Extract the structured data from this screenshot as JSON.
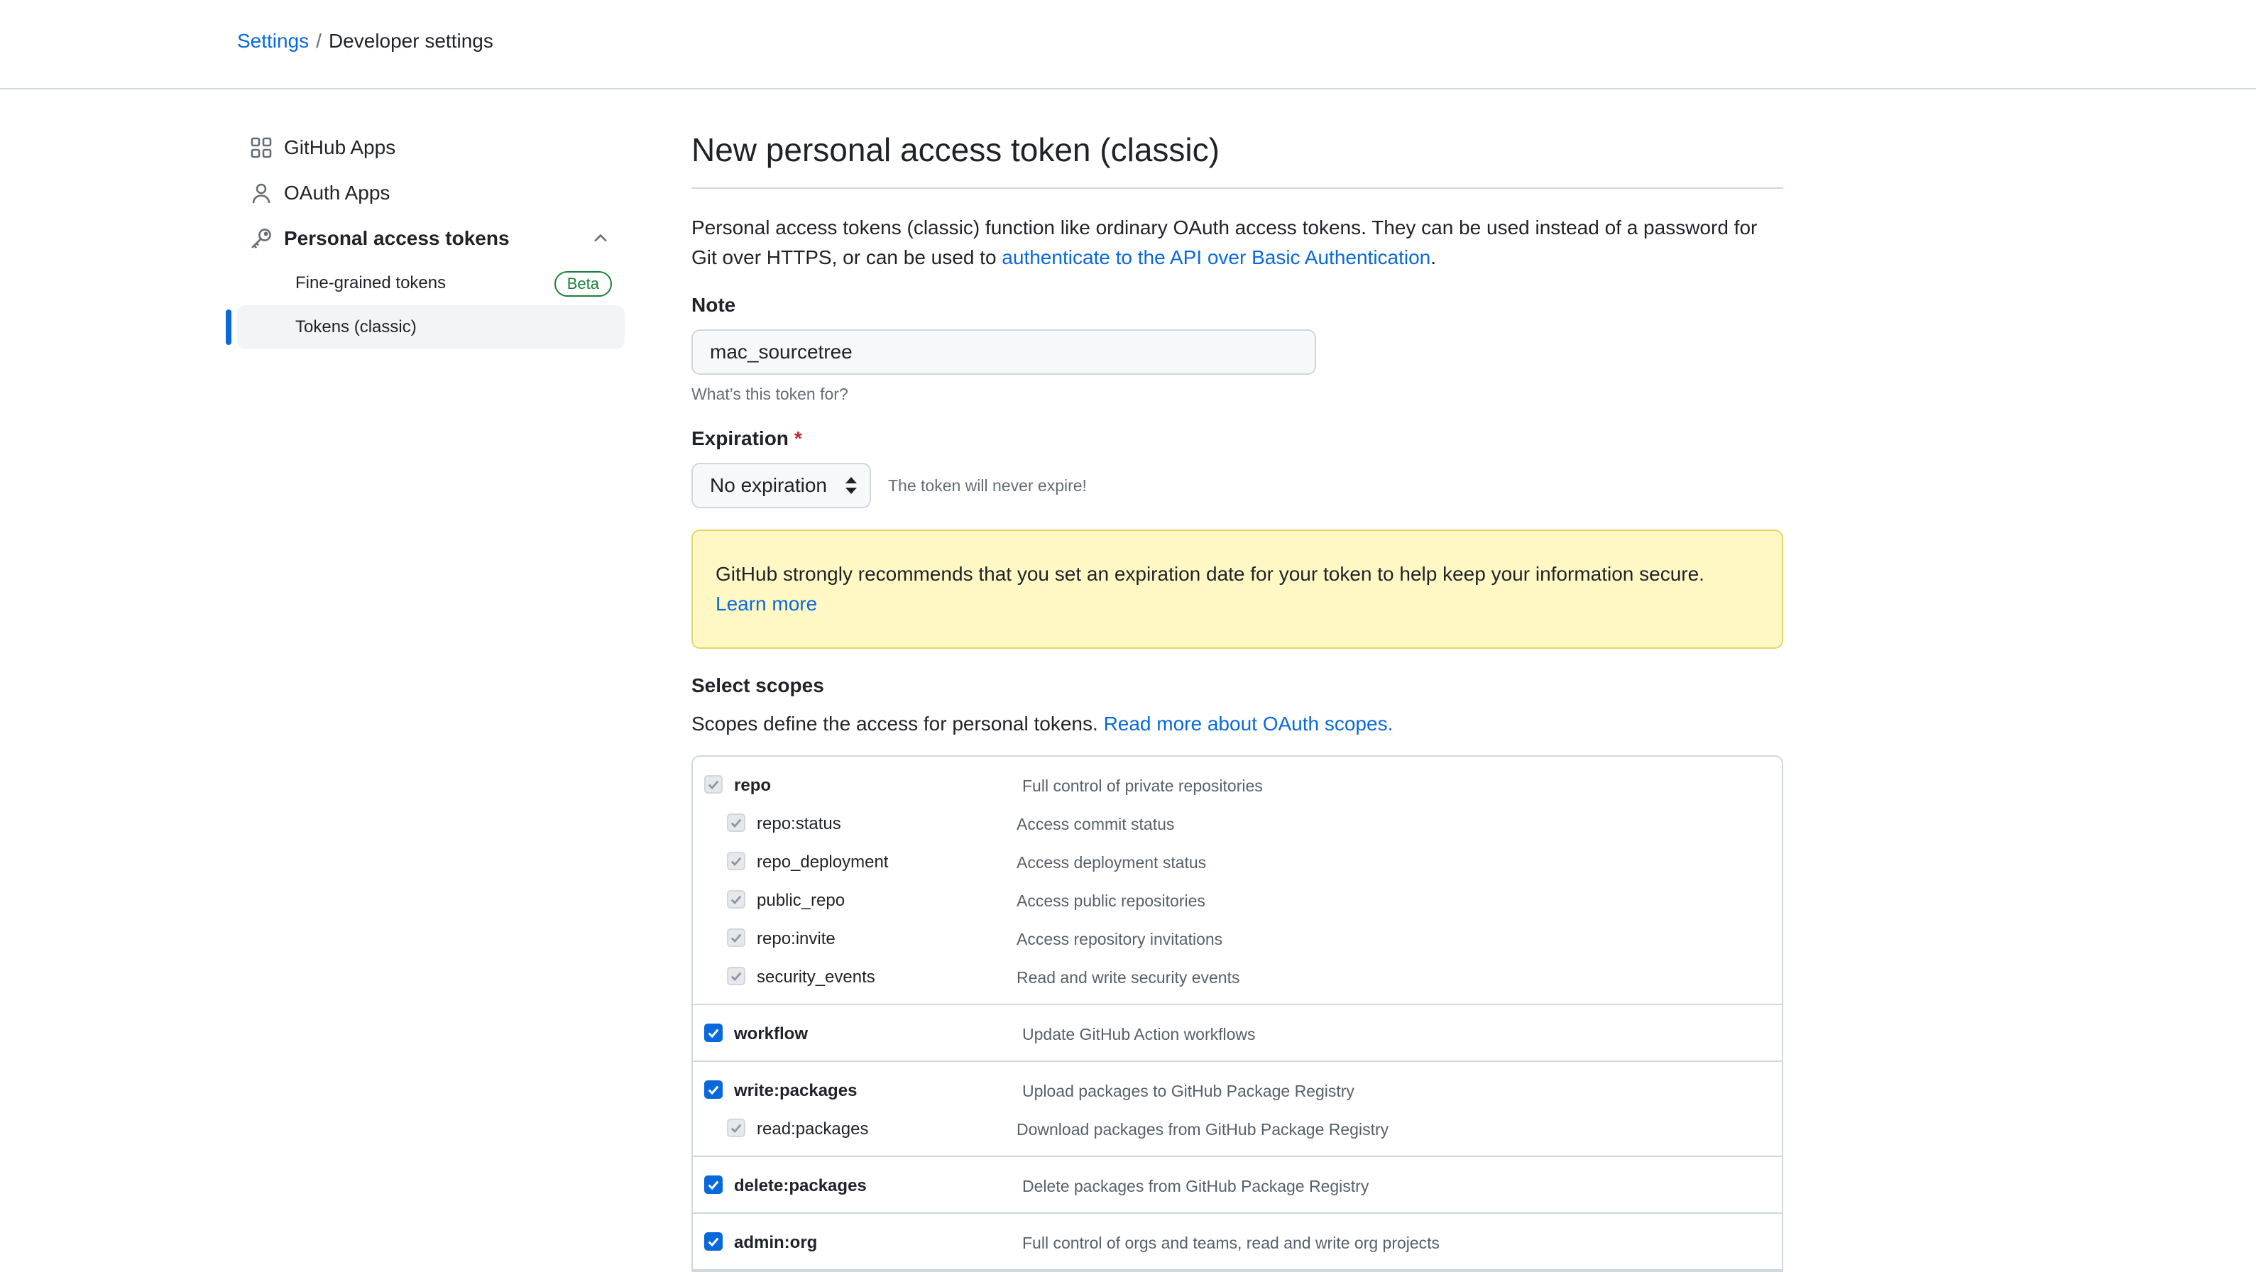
{
  "breadcrumb": {
    "parent": "Settings",
    "separator": "/",
    "current": "Developer settings"
  },
  "sidebar": {
    "items": [
      {
        "label": "GitHub Apps",
        "icon": "apps-icon"
      },
      {
        "label": "OAuth Apps",
        "icon": "person-icon"
      },
      {
        "label": "Personal access tokens",
        "icon": "key-icon",
        "expanded": true
      }
    ],
    "subitems": [
      {
        "label": "Fine-grained tokens",
        "badge": "Beta"
      },
      {
        "label": "Tokens (classic)",
        "active": true
      }
    ]
  },
  "main": {
    "title": "New personal access token (classic)",
    "intro_text": "Personal access tokens (classic) function like ordinary OAuth access tokens. They can be used instead of a password for Git over HTTPS, or can be used to ",
    "intro_link": "authenticate to the API over Basic Authentication",
    "intro_end": ".",
    "note_label": "Note",
    "note_value": "mac_sourcetree",
    "note_hint": "What’s this token for?",
    "expiration_label": "Expiration",
    "expiration_required": "*",
    "expiration_value": "No expiration",
    "expiration_note": "The token will never expire!",
    "flash_text": "GitHub strongly recommends that you set an expiration date for your token to help keep your information secure.",
    "flash_link": "Learn more",
    "scopes_heading": "Select scopes",
    "scopes_text": "Scopes define the access for personal tokens. ",
    "scopes_link": "Read more about OAuth scopes."
  },
  "scopes": [
    {
      "name": "repo",
      "desc": "Full control of private repositories",
      "state": "disabled",
      "children": [
        {
          "name": "repo:status",
          "desc": "Access commit status"
        },
        {
          "name": "repo_deployment",
          "desc": "Access deployment status"
        },
        {
          "name": "public_repo",
          "desc": "Access public repositories"
        },
        {
          "name": "repo:invite",
          "desc": "Access repository invitations"
        },
        {
          "name": "security_events",
          "desc": "Read and write security events"
        }
      ]
    },
    {
      "name": "workflow",
      "desc": "Update GitHub Action workflows",
      "state": "checked",
      "children": []
    },
    {
      "name": "write:packages",
      "desc": "Upload packages to GitHub Package Registry",
      "state": "checked",
      "children": [
        {
          "name": "read:packages",
          "desc": "Download packages from GitHub Package Registry"
        }
      ]
    },
    {
      "name": "delete:packages",
      "desc": "Delete packages from GitHub Package Registry",
      "state": "checked",
      "children": []
    },
    {
      "name": "admin:org",
      "desc": "Full control of orgs and teams, read and write org projects",
      "state": "checked",
      "children": []
    }
  ],
  "colors": {
    "link": "#0969da",
    "accent_bar": "#0969da",
    "flash_bg": "#fff8c5",
    "beta": "#1a7f37",
    "required": "#cf222e"
  }
}
